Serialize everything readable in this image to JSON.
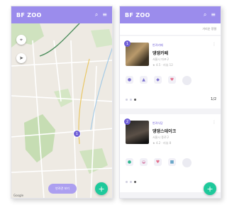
{
  "app": {
    "brand": "BF ZOO",
    "accent": "#9b8cec",
    "pin_color": "#6f5fd6",
    "fab_color": "#1ec99b"
  },
  "map_screen": {
    "header": {
      "logo": "BF ZOO",
      "icons": [
        "search-icon",
        "menu-icon"
      ]
    },
    "controls": {
      "location_icon": "crosshair-icon",
      "navigate_icon": "arrow-icon"
    },
    "pins": [
      {
        "label": "1"
      }
    ],
    "credit": "Google",
    "pill_button": "반려견 보기",
    "fab": "+"
  },
  "list_screen": {
    "header": {
      "logo": "BF ZOO",
      "icons": [
        "search-icon",
        "menu-icon"
      ]
    },
    "sort_label": "거리순 정렬",
    "cards": [
      {
        "badge": "1",
        "category": "반려카페",
        "title": "댕댕카페",
        "meta": [
          "서울시 마포구",
          "★ 4.5 · 리뷰 12"
        ],
        "amenities": [
          "dog-icon",
          "cat-icon",
          "leash-icon",
          "heart-icon",
          "plus-icon"
        ],
        "page_num": "1/2"
      },
      {
        "badge": "2",
        "category": "반려식당",
        "title": "댕댕스테이크",
        "meta": [
          "서울시 종로구",
          "★ 4.2 · 리뷰 8"
        ],
        "amenities": [
          "paw-icon",
          "bowl-icon",
          "heart-icon",
          "bed-icon",
          "plus-icon"
        ],
        "page_num": ""
      }
    ],
    "fab": "+"
  }
}
